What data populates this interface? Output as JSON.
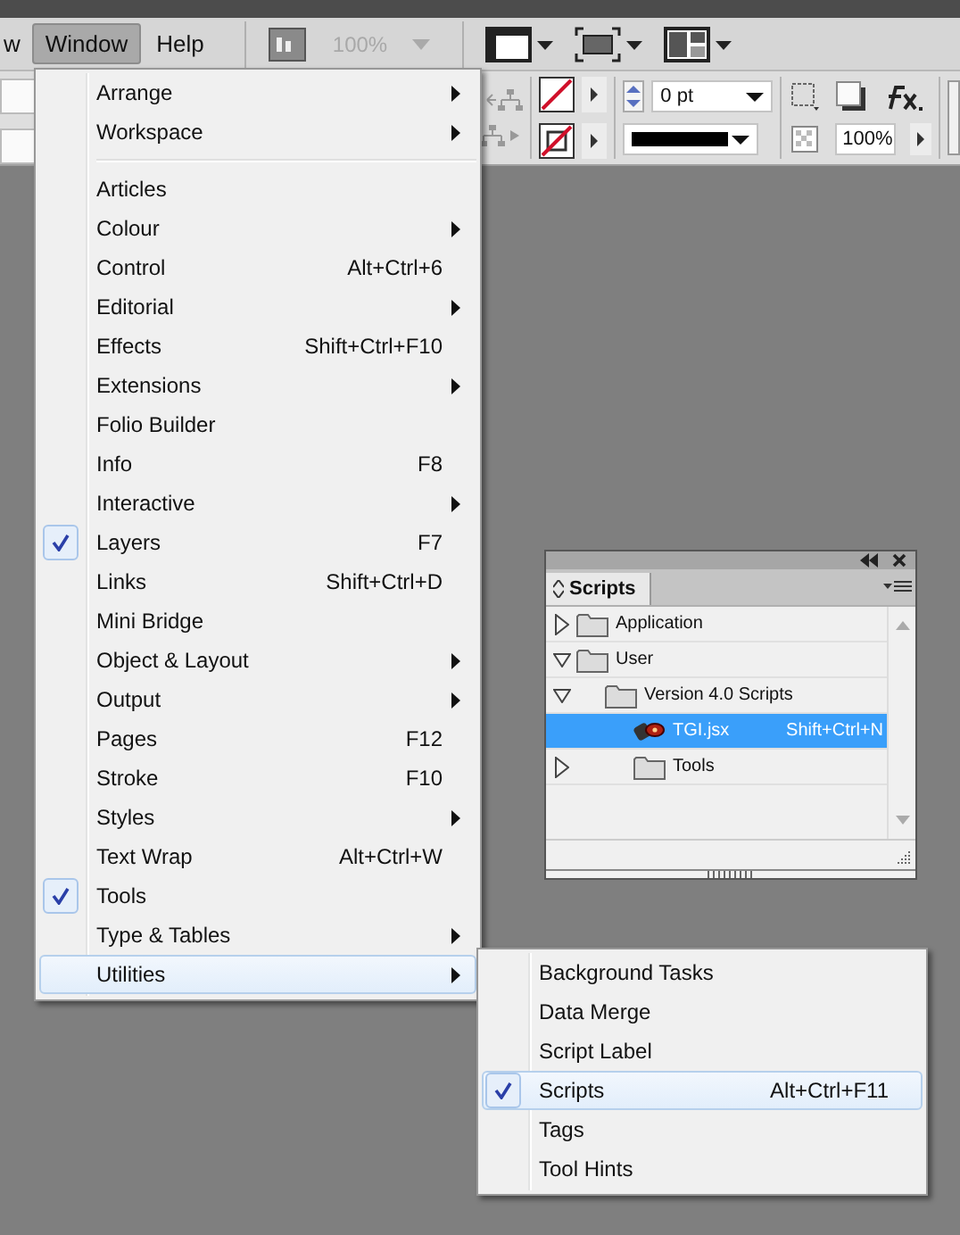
{
  "menubar": [
    {
      "label": "w",
      "selected": false
    },
    {
      "label": "Window",
      "selected": true
    },
    {
      "label": "Help",
      "selected": false
    }
  ],
  "toolbar": {
    "zoom": "100%",
    "stroke_weight": "0 pt",
    "opacity": "100%"
  },
  "window_menu": {
    "groups": [
      [
        {
          "label": "Arrange",
          "submenu": true,
          "checked": false,
          "selected": false
        },
        {
          "label": "Workspace",
          "submenu": true,
          "checked": false,
          "selected": false
        }
      ],
      [
        {
          "label": "Articles",
          "submenu": false,
          "checked": false,
          "selected": false
        },
        {
          "label": "Colour",
          "submenu": true,
          "checked": false,
          "selected": false
        },
        {
          "label": "Control",
          "shortcut": "Alt+Ctrl+6",
          "submenu": false,
          "checked": false,
          "selected": false
        },
        {
          "label": "Editorial",
          "submenu": true,
          "checked": false,
          "selected": false
        },
        {
          "label": "Effects",
          "shortcut": "Shift+Ctrl+F10",
          "submenu": false,
          "checked": false,
          "selected": false
        },
        {
          "label": "Extensions",
          "submenu": true,
          "checked": false,
          "selected": false
        },
        {
          "label": "Folio Builder",
          "submenu": false,
          "checked": false,
          "selected": false
        },
        {
          "label": "Info",
          "shortcut": "F8",
          "submenu": false,
          "checked": false,
          "selected": false
        },
        {
          "label": "Interactive",
          "submenu": true,
          "checked": false,
          "selected": false
        },
        {
          "label": "Layers",
          "shortcut": "F7",
          "submenu": false,
          "checked": true,
          "selected": false
        },
        {
          "label": "Links",
          "shortcut": "Shift+Ctrl+D",
          "submenu": false,
          "checked": false,
          "selected": false
        },
        {
          "label": "Mini Bridge",
          "submenu": false,
          "checked": false,
          "selected": false
        },
        {
          "label": "Object & Layout",
          "submenu": true,
          "checked": false,
          "selected": false
        },
        {
          "label": "Output",
          "submenu": true,
          "checked": false,
          "selected": false
        },
        {
          "label": "Pages",
          "shortcut": "F12",
          "submenu": false,
          "checked": false,
          "selected": false
        },
        {
          "label": "Stroke",
          "shortcut": "F10",
          "submenu": false,
          "checked": false,
          "selected": false
        },
        {
          "label": "Styles",
          "submenu": true,
          "checked": false,
          "selected": false
        },
        {
          "label": "Text Wrap",
          "shortcut": "Alt+Ctrl+W",
          "submenu": false,
          "checked": false,
          "selected": false
        },
        {
          "label": "Tools",
          "submenu": false,
          "checked": true,
          "selected": false
        },
        {
          "label": "Type & Tables",
          "submenu": true,
          "checked": false,
          "selected": false
        },
        {
          "label": "Utilities",
          "submenu": true,
          "checked": false,
          "selected": true
        }
      ]
    ]
  },
  "utilities_menu": {
    "items": [
      {
        "label": "Background Tasks",
        "checked": false,
        "selected": false
      },
      {
        "label": "Data Merge",
        "checked": false,
        "selected": false
      },
      {
        "label": "Script Label",
        "checked": false,
        "selected": false
      },
      {
        "label": "Scripts",
        "shortcut": "Alt+Ctrl+F11",
        "checked": true,
        "selected": true
      },
      {
        "label": "Tags",
        "checked": false,
        "selected": false
      },
      {
        "label": "Tool Hints",
        "checked": false,
        "selected": false
      }
    ]
  },
  "scripts_panel": {
    "tab": "Scripts",
    "tree": [
      {
        "kind": "folder",
        "label": "Application",
        "expanded": false,
        "selected": false
      },
      {
        "kind": "folder",
        "label": "User",
        "expanded": true,
        "selected": false,
        "children": [
          {
            "kind": "folder",
            "label": "Version 4.0 Scripts",
            "expanded": true,
            "selected": false,
            "children": [
              {
                "kind": "script",
                "label": "TGI.jsx",
                "shortcut": "Shift+Ctrl+N",
                "selected": true
              },
              {
                "kind": "folder",
                "label": "Tools",
                "expanded": false,
                "selected": false
              }
            ]
          }
        ]
      }
    ]
  }
}
